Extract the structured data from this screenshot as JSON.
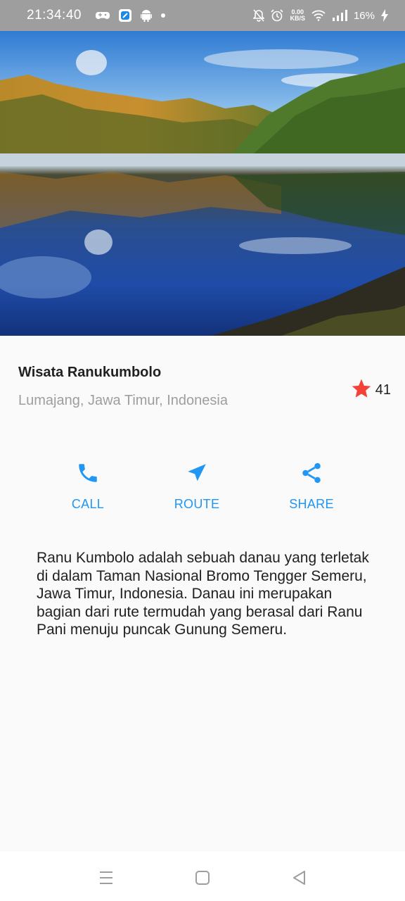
{
  "status_bar": {
    "time": "21:34:40",
    "left_icons": [
      "game-controller-icon",
      "app-icon",
      "android-icon",
      "dot-icon"
    ],
    "net_speed_value": "0.00",
    "net_speed_unit": "KB/S",
    "battery_percent": "16%",
    "right_icons": [
      "mute-bell-icon",
      "alarm-icon",
      "wifi-icon",
      "signal-icon",
      "charging-icon"
    ]
  },
  "place": {
    "title": "Wisata Ranukumbolo",
    "location": "Lumajang, Jawa Timur, Indonesia",
    "rating_count": "41",
    "rating_color": "#f44336"
  },
  "actions": [
    {
      "label": "CALL",
      "icon": "phone-icon"
    },
    {
      "label": "ROUTE",
      "icon": "navigation-icon"
    },
    {
      "label": "SHARE",
      "icon": "share-icon"
    }
  ],
  "accent_color": "#2196f3",
  "description": "Ranu Kumbolo adalah sebuah danau yang terletak di dalam Taman Nasional Bromo Tengger Semeru, Jawa Timur, Indonesia. Danau ini merupakan bagian dari rute termudah yang berasal dari Ranu Pani menuju puncak Gunung Semeru.",
  "nav_bar": {
    "buttons": [
      "menu-icon",
      "home-icon",
      "back-icon"
    ]
  }
}
